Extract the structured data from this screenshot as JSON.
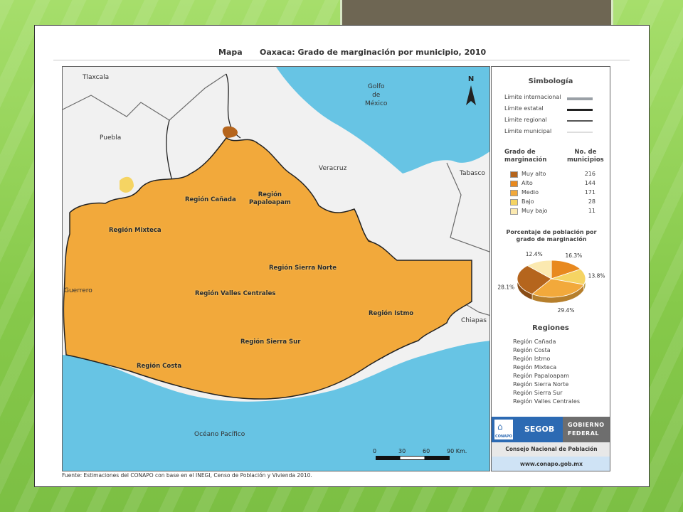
{
  "map": {
    "label": "Mapa",
    "title": "Oaxaca: Grado de marginación por municipio, 2010",
    "place_labels": {
      "tlaxcala": "Tlaxcala",
      "puebla": "Puebla",
      "veracruz": "Veracruz",
      "golfo": "Golfo\nde\nMéxico",
      "tabasco": "Tabasco",
      "guerrero": "Guerrero",
      "chiapas": "Chiapas",
      "oceano": "Océano Pacífico"
    },
    "region_labels": {
      "canada": "Región Cañada",
      "papaloapam": "Región\nPapaloapam",
      "mixteca": "Región Mixteca",
      "sierra_norte": "Región Sierra Norte",
      "valles": "Región Valles Centrales",
      "istmo": "Región Istmo",
      "sierra_sur": "Región Sierra Sur",
      "costa": "Región Costa"
    },
    "north": "N",
    "scale": {
      "ticks": [
        "0",
        "30",
        "60",
        "90 Km."
      ]
    },
    "colors": {
      "sea": "#67c4e4",
      "land": "#f1f1f1",
      "muy_alto": "#b5651d",
      "alto": "#e8891f",
      "medio": "#f2a93b",
      "bajo": "#f5d463",
      "muy_bajo": "#fbe9b0"
    }
  },
  "legend": {
    "simbologia": "Simbología",
    "limites": [
      {
        "label": "Límite internacional",
        "color": "#9aa0a6",
        "width": 4
      },
      {
        "label": "Límite estatal",
        "color": "#222222",
        "width": 2.5
      },
      {
        "label": "Límite regional",
        "color": "#555555",
        "width": 1.5
      },
      {
        "label": "Límite municipal",
        "color": "#dddddd",
        "width": 1.5
      }
    ],
    "grado_header": "Grado de\nmarginación",
    "no_header": "No. de\nmunicipios",
    "categories": [
      {
        "name": "Muy alto",
        "count": "216",
        "color": "#b5651d"
      },
      {
        "name": "Alto",
        "count": "144",
        "color": "#e8891f"
      },
      {
        "name": "Medio",
        "count": "171",
        "color": "#f2a93b"
      },
      {
        "name": "Bajo",
        "count": "28",
        "color": "#f5d463"
      },
      {
        "name": "Muy bajo",
        "count": "11",
        "color": "#fbe9b0"
      }
    ],
    "pie_title": "Porcentaje de población por\ngrado de marginación",
    "pie": [
      {
        "label": "16.3%",
        "value": 16.3,
        "color": "#e8891f"
      },
      {
        "label": "13.8%",
        "value": 13.8,
        "color": "#f5d463"
      },
      {
        "label": "29.4%",
        "value": 29.4,
        "color": "#f2a93b"
      },
      {
        "label": "28.1%",
        "value": 28.1,
        "color": "#b5651d"
      },
      {
        "label": "12.4%",
        "value": 12.4,
        "color": "#fbe9b0"
      }
    ],
    "regiones_title": "Regiones",
    "regiones": [
      "Región Cañada",
      "Región Costa",
      "Región Istmo",
      "Región Mixteca",
      "Región Papaloapam",
      "Región Sierra Norte",
      "Región Sierra Sur",
      "Región Valles Centrales"
    ],
    "logos": {
      "conapo": "CONAPO",
      "segob": "SEGOB",
      "gobierno_1": "GOBIERNO",
      "gobierno_2": "FEDERAL",
      "consejo": "Consejo Nacional de Población",
      "www": "www.conapo.gob.mx"
    }
  },
  "fuente": "Fuente: Estimaciones del CONAPO con base en el INEGI, Censo de Población y Vivienda 2010."
}
